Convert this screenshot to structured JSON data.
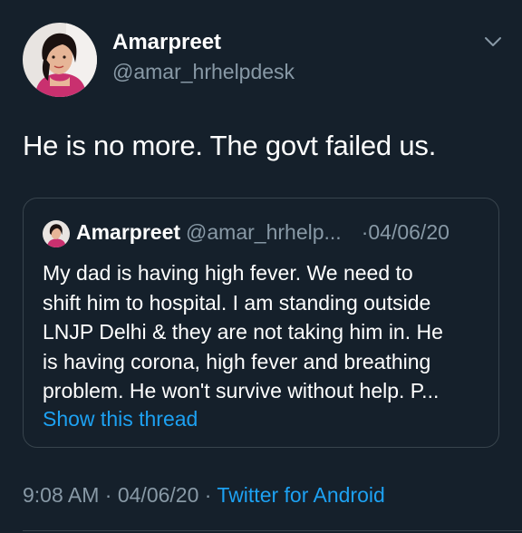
{
  "tweet": {
    "author": {
      "display_name": "Amarpreet",
      "handle": "@amar_hrhelpdesk"
    },
    "text": "He is no more. The govt failed us.",
    "quoted": {
      "display_name": "Amarpreet",
      "handle": "@amar_hrhelp...",
      "separator": "·",
      "date": "04/06/20",
      "lines": [
        "My dad is having high fever. We need to",
        "shift him to hospital. I am standing outside",
        "LNJP Delhi & they are not taking him in. He",
        "is having corona, high fever and breathing",
        "problem. He won't survive without help. P..."
      ],
      "show_thread": "Show this thread"
    },
    "meta": {
      "time": "9:08 AM",
      "sep1": "·",
      "date": "04/06/20",
      "sep2": "·",
      "source": "Twitter for Android"
    }
  },
  "icons": {
    "menu": "chevron-down-icon"
  },
  "colors": {
    "background": "#15202b",
    "primary_text": "#ffffff",
    "secondary_text": "#8899a6",
    "link": "#1da1f2",
    "border": "#38444d"
  }
}
